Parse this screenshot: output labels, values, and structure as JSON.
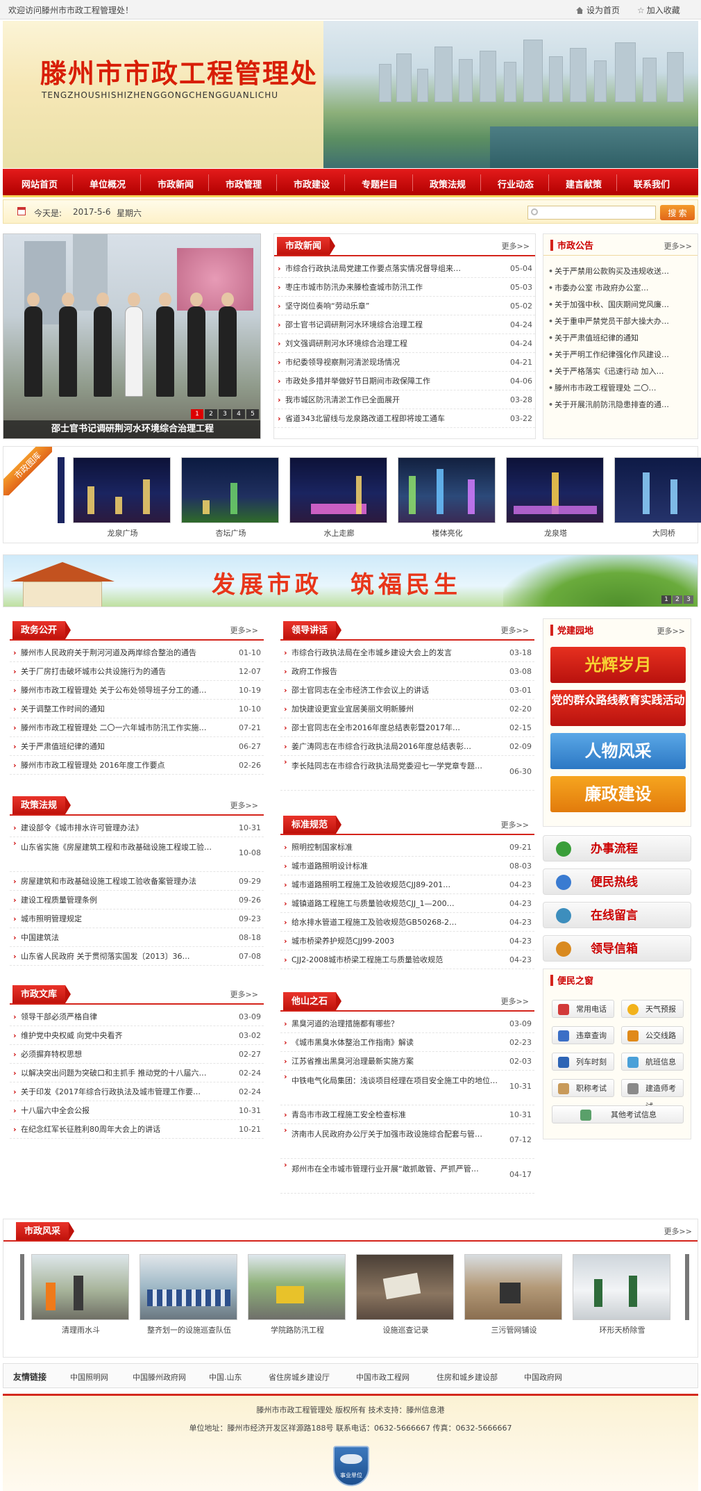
{
  "topbar": {
    "welcome": "欢迎访问滕州市市政工程管理处！",
    "set_home": "设为首页",
    "add_fav": "加入收藏"
  },
  "banner": {
    "title": "滕州市市政工程管理处",
    "subtitle": "TENGZHOUSHISHIZHENGGONGCHENGGUANLICHU"
  },
  "nav": [
    "网站首页",
    "单位概况",
    "市政新闻",
    "市政管理",
    "市政建设",
    "专题栏目",
    "政策法规",
    "行业动态",
    "建言献策",
    "联系我们"
  ],
  "datebar": {
    "today_label": "今天是:",
    "date": "2017-5-6",
    "weekday": "星期六",
    "search_button": "搜 索"
  },
  "slideshow": {
    "caption": "邵士官书记调研荆河水环境综合治理工程",
    "pages": [
      "1",
      "2",
      "3",
      "4",
      "5"
    ]
  },
  "more_label": "更多>>",
  "news": {
    "title": "市政新闻",
    "items": [
      {
        "t": "市综合行政执法局党建工作要点落实情况督导组来…",
        "d": "05-04"
      },
      {
        "t": "枣庄市城市防汛办来滕检查城市防汛工作",
        "d": "05-03"
      },
      {
        "t": "坚守岗位奏响“劳动乐章”",
        "d": "05-02"
      },
      {
        "t": "邵士官书记调研荆河水环境综合治理工程",
        "d": "04-24"
      },
      {
        "t": "刘文强调研荆河水环境综合治理工程",
        "d": "04-24"
      },
      {
        "t": "市纪委领导视察荆河清淤现场情况",
        "d": "04-21"
      },
      {
        "t": "市政处多措并举做好节日期间市政保障工作",
        "d": "04-06"
      },
      {
        "t": "我市城区防汛清淤工作已全面展开",
        "d": "03-28"
      },
      {
        "t": "省道343北留线与龙泉路改道工程即将竣工通车",
        "d": "03-22"
      }
    ]
  },
  "notice": {
    "title": "市政公告",
    "items": [
      "关于严禁用公款购买及违规收送…",
      "市委办公室 市政府办公室…",
      "关于加强中秋、国庆期间党风廉…",
      "关于重申严禁党员干部大操大办…",
      "关于严肃值班纪律的通知",
      "关于严明工作纪律强化作风建设…",
      "关于严格落实《迅速行动 加入…",
      "滕州市市政工程管理处 二〇…",
      "关于开展汛前防汛隐患排查的通…"
    ]
  },
  "gallery": {
    "tag": "市政图库",
    "items": [
      "龙泉广场",
      "杏坛广场",
      "水上走廊",
      "楼体亮化",
      "龙泉塔",
      "大同桥"
    ]
  },
  "ad": {
    "slogan": "发展市政　筑福民生",
    "pages": [
      "1",
      "2",
      "3"
    ]
  },
  "zhengwu": {
    "title": "政务公开",
    "items": [
      {
        "t": "滕州市人民政府关于荆河河道及两岸综合整治的通告",
        "d": "01-10"
      },
      {
        "t": "关于厂房打击破坏城市公共设施行为的通告",
        "d": "12-07"
      },
      {
        "t": "滕州市市政工程管理处 关于公布处领导班子分工的通…",
        "d": "10-19"
      },
      {
        "t": "关于调整工作时间的通知",
        "d": "10-10"
      },
      {
        "t": "滕州市市政工程管理处 二〇一六年城市防汛工作实施…",
        "d": "07-21"
      },
      {
        "t": "关于严肃值班纪律的通知",
        "d": "06-27"
      },
      {
        "t": "滕州市市政工程管理处 2016年度工作要点",
        "d": "02-26"
      }
    ]
  },
  "leader": {
    "title": "领导讲话",
    "items": [
      {
        "t": "市综合行政执法局在全市城乡建设大会上的发言",
        "d": "03-18"
      },
      {
        "t": "政府工作报告",
        "d": "03-08"
      },
      {
        "t": "邵士官同志在全市经济工作会议上的讲话",
        "d": "03-01"
      },
      {
        "t": "加快建设更宜业宜居美丽文明新滕州",
        "d": "02-20"
      },
      {
        "t": "邵士官同志在全市2016年度总结表彰暨2017年…",
        "d": "02-15"
      },
      {
        "t": "姜广涛同志在市综合行政执法局2016年度总结表彰…",
        "d": "02-09"
      },
      {
        "t": "李长陆同志在市综合行政执法局党委迎七一学党章专题…",
        "d": "06-30"
      }
    ]
  },
  "policy": {
    "title": "政策法规",
    "items": [
      {
        "t": "建设部令《城市排水许可管理办法》",
        "d": "10-31"
      },
      {
        "t": "山东省实施《房屋建筑工程和市政基础设施工程竣工验…",
        "d": "10-08"
      },
      {
        "t": "房屋建筑和市政基础设施工程竣工验收备案管理办法",
        "d": "09-29"
      },
      {
        "t": "建设工程质量管理条例",
        "d": "09-26"
      },
      {
        "t": "城市照明管理规定",
        "d": "09-23"
      },
      {
        "t": "中国建筑法",
        "d": "08-18"
      },
      {
        "t": "山东省人民政府 关于贯彻落实国发〔2013〕36…",
        "d": "07-08"
      }
    ]
  },
  "standard": {
    "title": "标准规范",
    "items": [
      {
        "t": "照明控制国家标准",
        "d": "09-21"
      },
      {
        "t": "城市道路照明设计标准",
        "d": "08-03"
      },
      {
        "t": "城市道路照明工程施工及验收规范CJJ89-201…",
        "d": "04-23"
      },
      {
        "t": "城镇道路工程施工与质量验收规范CJJ_1—200…",
        "d": "04-23"
      },
      {
        "t": "给水排水管道工程施工及验收规范GB50268-2…",
        "d": "04-23"
      },
      {
        "t": "城市桥梁养护规范CJJ99-2003",
        "d": "04-23"
      },
      {
        "t": "CJJ2-2008城市桥梁工程施工与质量验收规范",
        "d": "04-23"
      }
    ]
  },
  "library": {
    "title": "市政文库",
    "items": [
      {
        "t": "领导干部必须严格自律",
        "d": "03-09"
      },
      {
        "t": "维护党中央权威 向党中央看齐",
        "d": "03-02"
      },
      {
        "t": "必须摒弃特权思想",
        "d": "02-27"
      },
      {
        "t": "以解决突出问题为突破口和主抓手 推动党的十八届六…",
        "d": "02-24"
      },
      {
        "t": "关于印发《2017年综合行政执法及城市管理工作要…",
        "d": "02-24"
      },
      {
        "t": "十八届六中全会公报",
        "d": "10-31"
      },
      {
        "t": "在纪念红军长征胜利80周年大会上的讲话",
        "d": "10-21"
      }
    ]
  },
  "stone": {
    "title": "他山之石",
    "items": [
      {
        "t": "黑臭河道的治理措施都有哪些？",
        "d": "03-09"
      },
      {
        "t": "《城市黑臭水体整治工作指南》解读",
        "d": "02-23"
      },
      {
        "t": "江苏省推出黑臭河治理最新实施方案",
        "d": "02-03"
      },
      {
        "t": "中铁电气化局集团：浅谈项目经理在项目安全施工中的地位…",
        "d": "10-31"
      },
      {
        "t": "青岛市市政工程施工安全检查标准",
        "d": "10-31"
      },
      {
        "t": "济南市人民政府办公厅关于加强市政设施综合配套与管…",
        "d": "07-12"
      },
      {
        "t": "郑州市在全市城市管理行业开展“敢抓敢管、严抓严管…",
        "d": "04-17"
      }
    ]
  },
  "party": {
    "title": "党建园地",
    "promos": [
      "光辉岁月",
      "党的群众路线教育实践活动",
      "人物风采",
      "廉政建设"
    ]
  },
  "services": [
    "办事流程",
    "便民热线",
    "在线留言",
    "领导信箱"
  ],
  "convenience": {
    "title": "便民之窗",
    "buttons": [
      "常用电话",
      "天气预报",
      "违章查询",
      "公交线路",
      "列车时刻",
      "航班信息",
      "职称考试",
      "建造师考试"
    ],
    "wide": "其他考试信息"
  },
  "walk": {
    "title": "市政风采",
    "items": [
      "清理雨水斗",
      "整齐划一的设施巡查队伍",
      "学院路防汛工程",
      "设施巡查记录",
      "三污管网铺设",
      "环形天桥除雪"
    ]
  },
  "links": {
    "title": "友情链接",
    "items": [
      "中国照明网",
      "中国滕州政府网",
      "中国.山东",
      "省住房城乡建设厅",
      "中国市政工程网",
      "住房和城乡建设部",
      "中国政府网"
    ]
  },
  "footer": {
    "line1": "滕州市市政工程管理处 版权所有 技术支持：滕州信息港",
    "line2": "单位地址：滕州市经济开发区祥源路188号 联系电话：0632-5666667 传真：0632-5666667",
    "badge": "事业单位"
  },
  "colors": {
    "brand_red": "#d81e06",
    "nav_red": "#c40a0a",
    "accent_orange": "#f08a24"
  }
}
